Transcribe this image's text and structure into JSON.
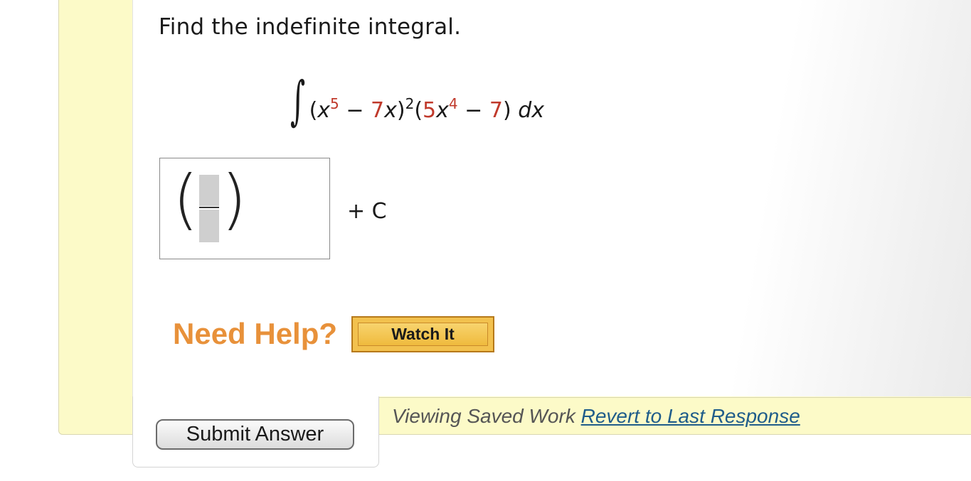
{
  "question": {
    "prompt": "Find the indefinite integral."
  },
  "integral": {
    "sign": "∫",
    "open1": "(",
    "var1": "x",
    "exp1": "5",
    "minus1": " − ",
    "coef1": "7",
    "var2": "x",
    "close1": ")",
    "exp2": "2",
    "open2": "(",
    "coef2": "5",
    "var3": "x",
    "exp3": "4",
    "minus2": " − ",
    "const1": "7",
    "close2": ")",
    "differential": " dx"
  },
  "answer": {
    "numerator_value": "",
    "denominator_value": "",
    "suffix": "+ C"
  },
  "help": {
    "label": "Need Help?",
    "watch_button": "Watch It"
  },
  "submit": {
    "label": "Submit Answer"
  },
  "status": {
    "saved_text": "Viewing Saved Work",
    "revert_link": "Revert to Last Response"
  },
  "colors": {
    "highlight_red": "#c0392b",
    "help_orange": "#e8913a",
    "panel_yellow": "#fcfac8",
    "link_blue": "#1f5c8a"
  }
}
